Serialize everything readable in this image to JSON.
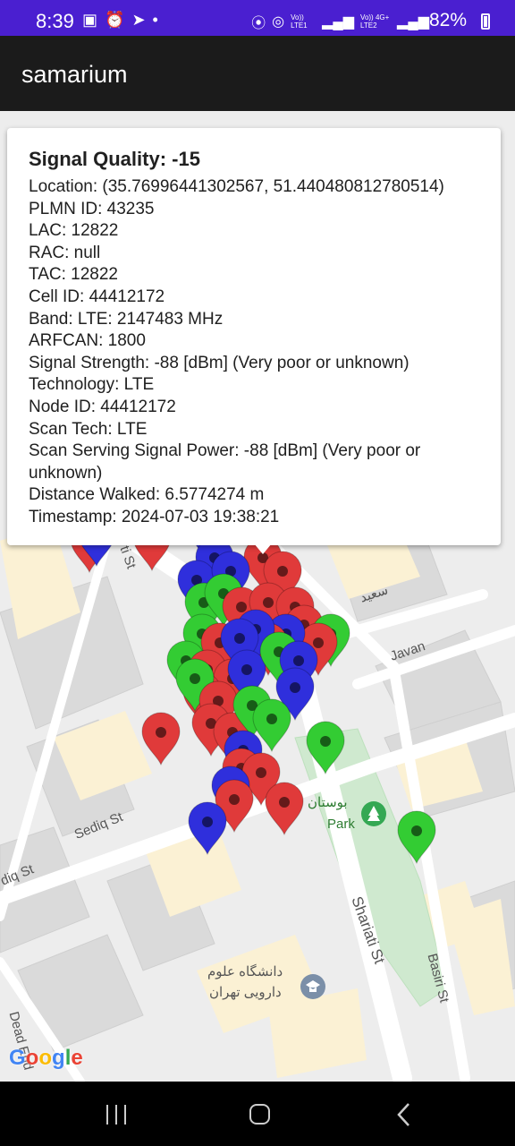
{
  "status_bar": {
    "time": "8:39",
    "battery": "82%",
    "net1": "Vo)) LTE1",
    "net2": "Vo)) 4G+ LTE2"
  },
  "app": {
    "title": "samarium"
  },
  "info_window": {
    "title": "Signal Quality: -15",
    "lines": [
      "Location: (35.76996441302567, 51.440480812780514)",
      "PLMN ID: 43235",
      "LAC: 12822",
      "RAC: null",
      "TAC: 12822",
      "Cell ID: 44412172",
      "Band: LTE: 2147483 MHz",
      "ARFCAN: 1800",
      "Signal Strength: -88 [dBm] (Very poor or unknown)",
      "Technology: LTE",
      "Node ID: 44412172",
      "Scan Tech: LTE",
      "Scan Serving Signal Power: -88 [dBm] (Very poor or unknown)",
      "Distance Walked: 6.5774274 m",
      "Timestamp: 2024-07-03 19:38:21"
    ]
  },
  "map": {
    "labels": {
      "sediq_st": "Sediq St",
      "sediq_st_left": "diq St",
      "javan": "Javan",
      "saeed": "سعید",
      "park_fa": "بوستان",
      "park": "Park",
      "shariati_st": "Shariati St",
      "basiri_st": "Basiri St",
      "uni_line1": "دانشگاه علوم",
      "uni_line2": "دارویی تهران",
      "ti_st": "ti St",
      "dead_end": "Dead End"
    },
    "logo": "Google",
    "marker_colors": {
      "red": "#e03a3a",
      "green": "#33cc33",
      "blue": "#2f2fdc"
    }
  }
}
